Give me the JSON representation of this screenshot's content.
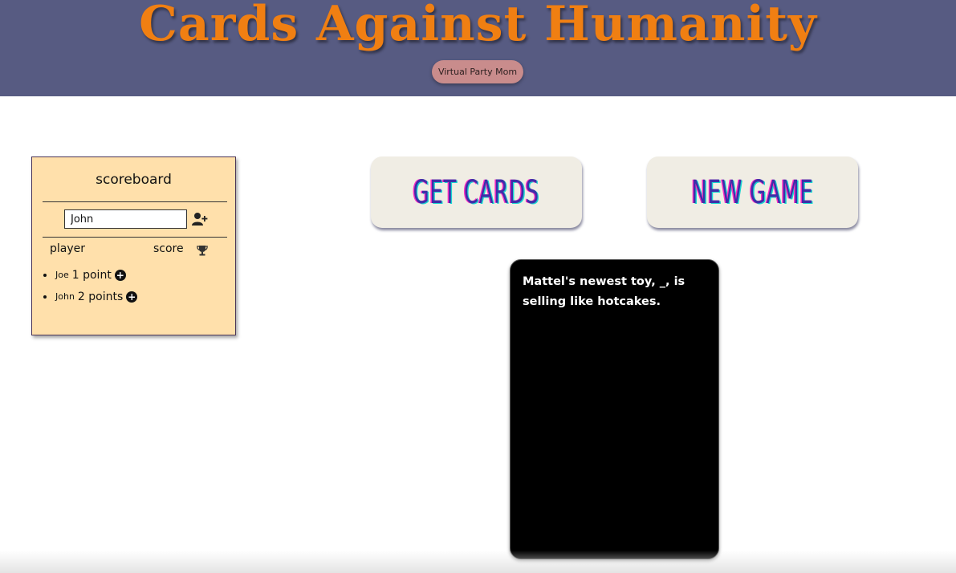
{
  "header": {
    "title": "Cards Against Humanity",
    "subtitle_button": "Virtual Party Mom"
  },
  "scoreboard": {
    "title": "scoreboard",
    "name_input_value": "John",
    "add_player_icon": "user-plus-icon",
    "col_player": "player",
    "col_score": "score",
    "score_icon": "trophy-icon",
    "players": [
      {
        "name": "Joe",
        "score": "1 point"
      },
      {
        "name": "John",
        "score": "2 points"
      }
    ]
  },
  "buttons": {
    "get_cards": "GET CARDS",
    "new_game": "NEW GAME"
  },
  "black_card": {
    "text": "Mattel's newest toy, _, is selling like hotcakes."
  },
  "colors": {
    "header_bg": "#575b82",
    "title": "#f07f12",
    "scoreboard_bg": "#ffe0ab",
    "card_bg": "#000000"
  }
}
